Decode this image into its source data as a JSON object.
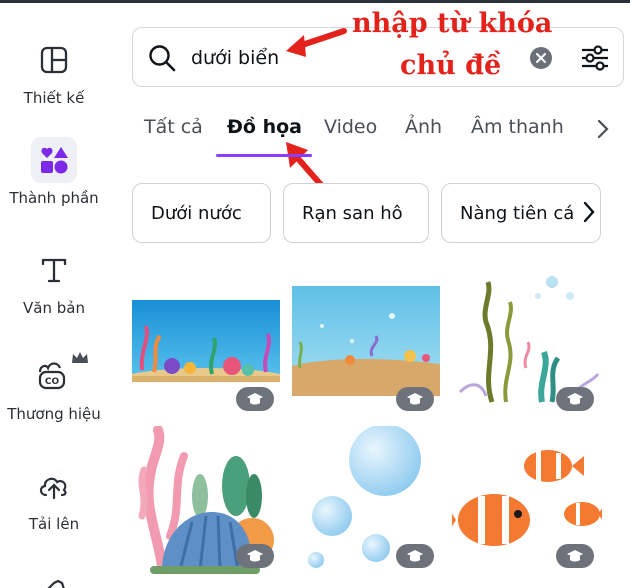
{
  "sidebar": {
    "items": [
      {
        "label": "Thiết kế",
        "icon": "layout-icon"
      },
      {
        "label": "Thành phần",
        "icon": "shapes-icon"
      },
      {
        "label": "Văn bản",
        "icon": "text-icon"
      },
      {
        "label": "Thương hiệu",
        "icon": "brand-icon"
      },
      {
        "label": "Tải lên",
        "icon": "cloud-upload-icon"
      }
    ]
  },
  "search": {
    "value": "dưới biển",
    "icon": "search-icon",
    "clear_icon": "close-icon",
    "filter_icon": "filter-icon"
  },
  "annotation": {
    "line1": "nhập từ khóa",
    "line2": "chủ đề",
    "color": "#e3231b"
  },
  "tabs": {
    "items": [
      "Tất cả",
      "Đồ họa",
      "Video",
      "Ảnh",
      "Âm thanh"
    ],
    "active": "Đồ họa",
    "accent": "#8b3dff"
  },
  "chips": [
    "Dưới nước",
    "Rạn san hô",
    "Nàng tiên cá"
  ],
  "results": {
    "items": [
      {
        "name": "underwater-reef-scene",
        "badge": "pro-crown-icon"
      },
      {
        "name": "sea-floor-scene",
        "badge": "pro-crown-icon"
      },
      {
        "name": "seaweed-bubbles",
        "badge": "pro-crown-icon"
      },
      {
        "name": "coral-shell-cluster",
        "badge": "pro-crown-icon"
      },
      {
        "name": "water-bubbles",
        "badge": "pro-crown-icon"
      },
      {
        "name": "clownfish-group",
        "badge": "pro-crown-icon"
      }
    ]
  }
}
